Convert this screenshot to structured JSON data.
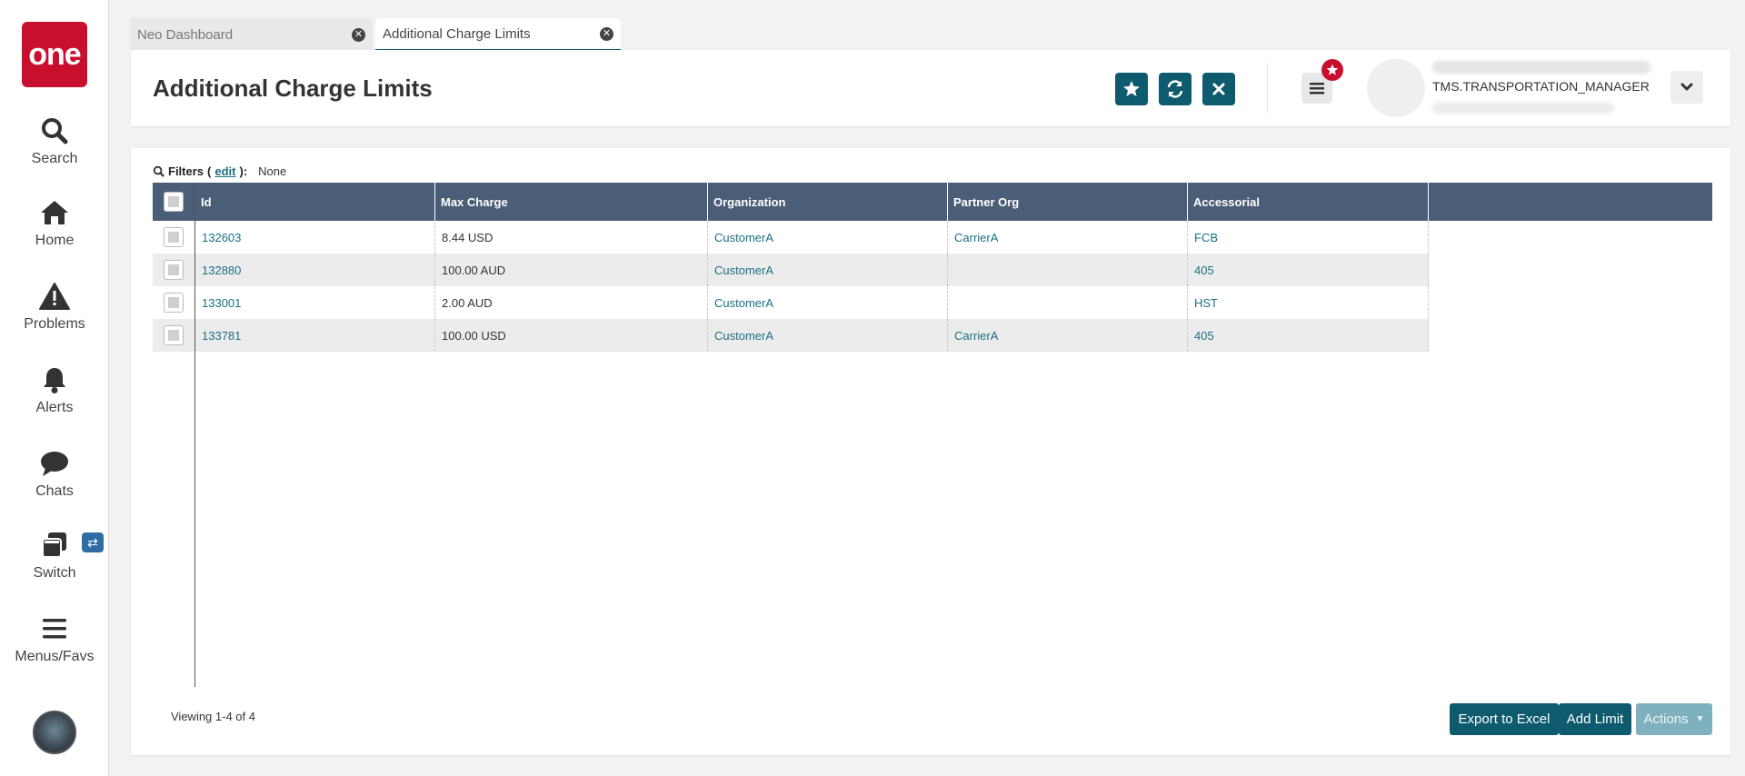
{
  "sidebar": {
    "logo": "one",
    "items": [
      {
        "label": "Search",
        "icon": "search-icon"
      },
      {
        "label": "Home",
        "icon": "home-icon"
      },
      {
        "label": "Problems",
        "icon": "warning-icon"
      },
      {
        "label": "Alerts",
        "icon": "bell-icon"
      },
      {
        "label": "Chats",
        "icon": "chat-icon"
      },
      {
        "label": "Switch",
        "icon": "switch-icon"
      },
      {
        "label": "Menus/Favs",
        "icon": "hamburger-icon"
      }
    ]
  },
  "tabs": [
    {
      "label": "Neo Dashboard",
      "active": false
    },
    {
      "label": "Additional Charge Limits",
      "active": true
    }
  ],
  "header": {
    "title": "Additional Charge Limits",
    "user_role": "TMS.TRANSPORTATION_MANAGER"
  },
  "filters": {
    "label": "Filters",
    "edit": "edit",
    "value": "None"
  },
  "table": {
    "columns": [
      "Id",
      "Max Charge",
      "Organization",
      "Partner Org",
      "Accessorial"
    ],
    "rows": [
      {
        "id": "132603",
        "max_charge": "8.44 USD",
        "organization": "CustomerA",
        "partner_org": "CarrierA",
        "accessorial": "FCB"
      },
      {
        "id": "132880",
        "max_charge": "100.00 AUD",
        "organization": "CustomerA",
        "partner_org": "",
        "accessorial": "405"
      },
      {
        "id": "133001",
        "max_charge": "2.00 AUD",
        "organization": "CustomerA",
        "partner_org": "",
        "accessorial": "HST"
      },
      {
        "id": "133781",
        "max_charge": "100.00 USD",
        "organization": "CustomerA",
        "partner_org": "CarrierA",
        "accessorial": "405"
      }
    ]
  },
  "footer": {
    "viewing": "Viewing 1-4 of 4",
    "export_label": "Export to Excel",
    "add_label": "Add Limit",
    "actions_label": "Actions"
  },
  "colors": {
    "accent": "#0e5a6e",
    "brand": "#c8102e",
    "grid_header": "#4a5e78",
    "link": "#1a6f86"
  }
}
